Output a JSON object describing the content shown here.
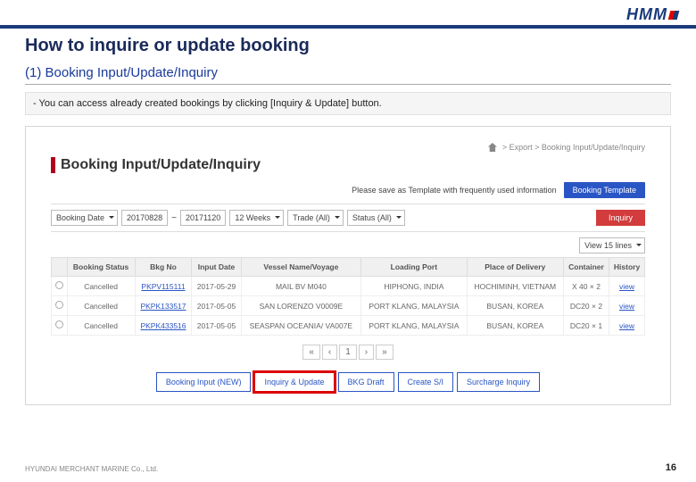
{
  "logo": "HMM",
  "title": "How to inquire or update booking",
  "subtitle": "(1) Booking Input/Update/Inquiry",
  "note": "- You can access already created bookings by clicking [Inquiry & Update] button.",
  "screenshot": {
    "breadcrumb": "> Export > Booking Input/Update/Inquiry",
    "heading": "Booking Input/Update/Inquiry",
    "save_hint": "Please save as Template with frequently used information",
    "template_btn": "Booking Template",
    "filters": {
      "booking_date_label": "Booking Date",
      "date_from": "20170828",
      "date_to": "20171120",
      "weeks": "12 Weeks",
      "trade": "Trade (All)",
      "status": "Status (All)"
    },
    "inquiry_btn": "Inquiry",
    "view_lines": "View 15 lines",
    "columns": [
      "",
      "Booking Status",
      "Bkg No",
      "Input Date",
      "Vessel Name/Voyage",
      "Loading Port",
      "Place of Delivery",
      "Container",
      "History"
    ],
    "rows": [
      {
        "status": "Cancelled",
        "bkg": "PKPV115111",
        "date": "2017-05-29",
        "vessel": "MAIL BV M040",
        "port": "HIPHONG, INDIA",
        "pod": "HOCHIMINH, VIETNAM",
        "cntr": "X 40 × 2",
        "hist": "view"
      },
      {
        "status": "Cancelled",
        "bkg": "PKPK133517",
        "date": "2017-05-05",
        "vessel": "SAN LORENZO V0009E",
        "port": "PORT KLANG, MALAYSIA",
        "pod": "BUSAN, KOREA",
        "cntr": "DC20 × 2",
        "hist": "view"
      },
      {
        "status": "Cancelled",
        "bkg": "PKPK433516",
        "date": "2017-05-05",
        "vessel": "SEASPAN OCEANIA/ VA007E",
        "port": "PORT KLANG, MALAYSIA",
        "pod": "BUSAN, KOREA",
        "cntr": "DC20 × 1",
        "hist": "view"
      }
    ],
    "pager": [
      "«",
      "‹",
      "1",
      "›",
      "»"
    ],
    "bottom_buttons": [
      "Booking Input (NEW)",
      "Inquiry & Update",
      "BKG Draft",
      "Create S/I",
      "Surcharge Inquiry"
    ],
    "highlight_index": 1
  },
  "footer": "HYUNDAI MERCHANT MARINE Co., Ltd.",
  "page_number": "16"
}
